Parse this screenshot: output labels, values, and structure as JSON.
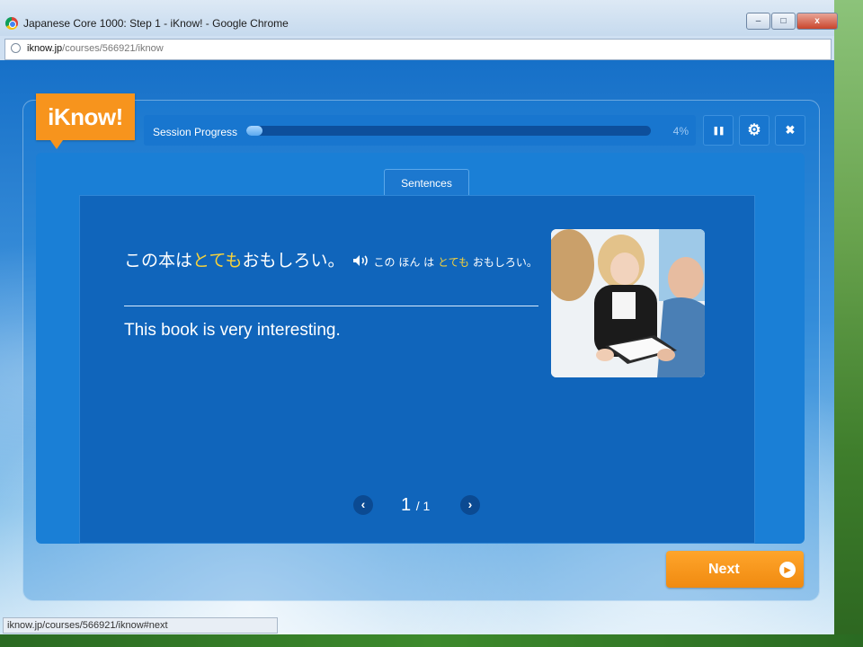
{
  "window": {
    "title": "Japanese Core 1000: Step 1 - iKnow! - Google Chrome",
    "controls": {
      "minimize": "‒",
      "maximize": "□",
      "close": "x"
    }
  },
  "address": {
    "host": "iknow.jp",
    "path": "/courses/566921/iknow"
  },
  "app": {
    "logo": "iKnow!",
    "progress": {
      "label": "Session Progress",
      "value_pct": 4,
      "value_text": "4%"
    },
    "controls": {
      "pause": "❚❚",
      "settings": "⚙",
      "close": "✖"
    },
    "tab": "Sentences",
    "sentence": {
      "jp_pre": "この本は",
      "jp_highlight": "とても",
      "jp_post": "おもしろい。",
      "kana_pre": "この ほん は ",
      "kana_highlight": "とても",
      "kana_post": " おもしろい。",
      "english": "This book is very interesting."
    },
    "pager": {
      "prev": "‹",
      "current": "1",
      "total": "/ 1",
      "next": "›"
    },
    "next_button": {
      "label": "Next",
      "arrow": "▶"
    }
  },
  "status_bar": "iknow.jp/courses/566921/iknow#next",
  "icons": [
    "chrome-icon",
    "globe-icon",
    "pause-icon",
    "gear-icon",
    "close-icon",
    "speaker-icon",
    "chevron-left-icon",
    "chevron-right-icon",
    "play-arrow-icon"
  ],
  "colors": {
    "accent": "#f7941d",
    "panel": "#1a7fd6",
    "highlight": "#f7d23a"
  }
}
